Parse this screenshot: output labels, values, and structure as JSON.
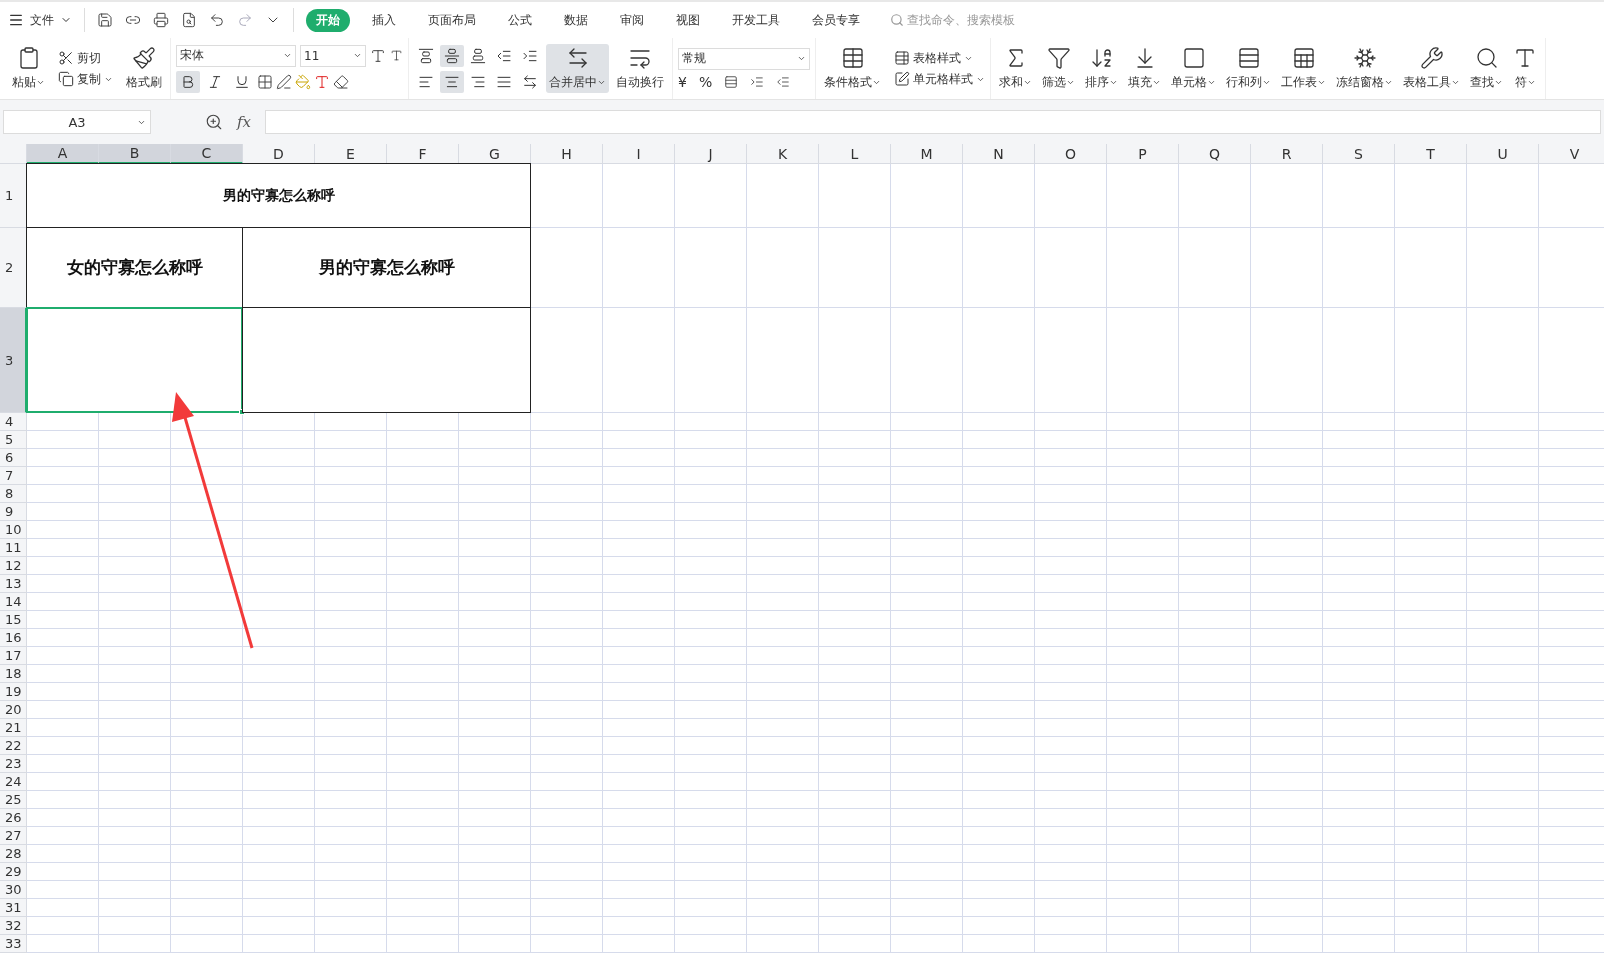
{
  "menu_bar": {
    "file_menu": "文件",
    "tabs": [
      {
        "label": "开始",
        "selected": true
      },
      {
        "label": "插入",
        "selected": false
      },
      {
        "label": "页面布局",
        "selected": false
      },
      {
        "label": "公式",
        "selected": false
      },
      {
        "label": "数据",
        "selected": false
      },
      {
        "label": "审阅",
        "selected": false
      },
      {
        "label": "视图",
        "selected": false
      },
      {
        "label": "开发工具",
        "selected": false
      },
      {
        "label": "会员专享",
        "selected": false
      }
    ],
    "search": {
      "placeholder": "查找命令、搜索模板"
    }
  },
  "ribbon": {
    "clipboard": {
      "paste": "粘贴",
      "cut": "剪切",
      "copy": "复制",
      "format_painter": "格式刷"
    },
    "font": {
      "name": "宋体",
      "size": "11",
      "bold": true,
      "italic": false,
      "underline": false
    },
    "align_top": [
      {
        "selected": false
      },
      {
        "selected": true
      },
      {
        "selected": false
      },
      {
        "selected": false
      },
      {
        "selected": false
      }
    ],
    "align_bottom": [
      {
        "selected": false
      },
      {
        "selected": true
      },
      {
        "selected": false
      },
      {
        "selected": false
      },
      {
        "selected": false
      }
    ],
    "merge": {
      "label": "合并居中",
      "selected": true
    },
    "wrap": "自动换行",
    "number": {
      "format": "常规",
      "currency": "¥",
      "percent": "%"
    },
    "styles": {
      "conditional": "条件格式",
      "table_style": "表格样式",
      "cell_style": "单元格样式"
    },
    "tools": [
      {
        "label": "求和"
      },
      {
        "label": "筛选"
      },
      {
        "label": "排序"
      },
      {
        "label": "填充"
      },
      {
        "label": "单元格"
      },
      {
        "label": "行和列"
      },
      {
        "label": "工作表"
      },
      {
        "label": "冻结窗格"
      },
      {
        "label": "表格工具"
      },
      {
        "label": "查找"
      },
      {
        "label": "符"
      }
    ]
  },
  "formula_bar": {
    "name_box": "A3",
    "fx": "fx"
  },
  "sheet": {
    "columns": [
      {
        "label": "A",
        "selected": true
      },
      {
        "label": "B",
        "selected": true
      },
      {
        "label": "C",
        "selected": true
      },
      {
        "label": "D",
        "selected": false
      },
      {
        "label": "E",
        "selected": false
      },
      {
        "label": "F",
        "selected": false
      },
      {
        "label": "G",
        "selected": false
      },
      {
        "label": "H",
        "selected": false
      },
      {
        "label": "I",
        "selected": false
      },
      {
        "label": "J",
        "selected": false
      },
      {
        "label": "K",
        "selected": false
      },
      {
        "label": "L",
        "selected": false
      },
      {
        "label": "M",
        "selected": false
      },
      {
        "label": "N",
        "selected": false
      },
      {
        "label": "O",
        "selected": false
      },
      {
        "label": "P",
        "selected": false
      },
      {
        "label": "Q",
        "selected": false
      },
      {
        "label": "R",
        "selected": false
      },
      {
        "label": "S",
        "selected": false
      },
      {
        "label": "T",
        "selected": false
      },
      {
        "label": "U",
        "selected": false
      },
      {
        "label": "V",
        "selected": false
      }
    ],
    "rows": [
      {
        "label": "1",
        "selected": false
      },
      {
        "label": "2",
        "selected": false
      },
      {
        "label": "3",
        "selected": true
      },
      {
        "label": "4",
        "selected": false
      },
      {
        "label": "5",
        "selected": false
      },
      {
        "label": "6",
        "selected": false
      },
      {
        "label": "7",
        "selected": false
      },
      {
        "label": "8",
        "selected": false
      },
      {
        "label": "9",
        "selected": false
      },
      {
        "label": "10",
        "selected": false
      },
      {
        "label": "11",
        "selected": false
      },
      {
        "label": "12",
        "selected": false
      },
      {
        "label": "13",
        "selected": false
      },
      {
        "label": "14",
        "selected": false
      },
      {
        "label": "15",
        "selected": false
      },
      {
        "label": "16",
        "selected": false
      },
      {
        "label": "17",
        "selected": false
      },
      {
        "label": "18",
        "selected": false
      },
      {
        "label": "19",
        "selected": false
      },
      {
        "label": "20",
        "selected": false
      },
      {
        "label": "21",
        "selected": false
      },
      {
        "label": "22",
        "selected": false
      },
      {
        "label": "23",
        "selected": false
      },
      {
        "label": "24",
        "selected": false
      },
      {
        "label": "25",
        "selected": false
      },
      {
        "label": "26",
        "selected": false
      },
      {
        "label": "27",
        "selected": false
      },
      {
        "label": "28",
        "selected": false
      },
      {
        "label": "29",
        "selected": false
      },
      {
        "label": "30",
        "selected": false
      },
      {
        "label": "31",
        "selected": false
      },
      {
        "label": "32",
        "selected": false
      },
      {
        "label": "33",
        "selected": false
      }
    ],
    "cells": [
      {
        "text": "男的守寡怎么称呼",
        "kind": "title",
        "selected": false
      },
      {
        "text": "女的守寡怎么称呼",
        "kind": "header",
        "selected": false
      },
      {
        "text": "男的守寡怎么称呼",
        "kind": "header",
        "selected": false
      },
      {
        "kind": "empty",
        "selected": true
      },
      {
        "kind": "empty",
        "selected": false
      }
    ]
  }
}
